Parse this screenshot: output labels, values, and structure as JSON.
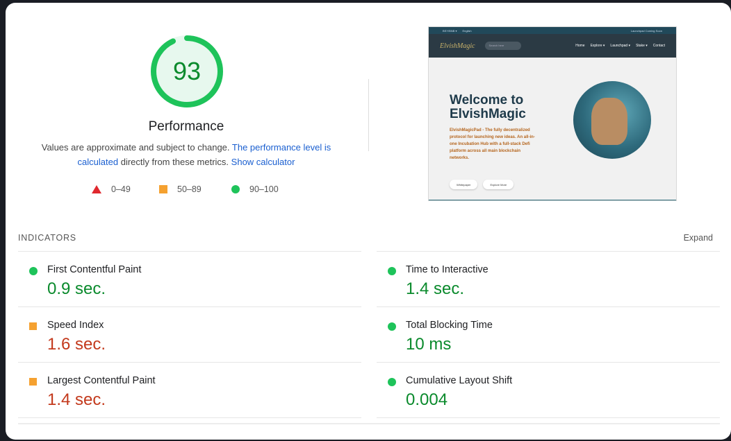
{
  "performance": {
    "score": "93",
    "score_fraction": 0.93,
    "title": "Performance",
    "desc_prefix": "Values are approximate and subject to change.",
    "desc_link1": "The performance level is calculated",
    "desc_middle": "directly from these metrics.",
    "desc_link2": "Show calculator"
  },
  "legend": [
    {
      "range": "0–49",
      "shape": "triangle",
      "color": "#e0282e"
    },
    {
      "range": "50–89",
      "shape": "square",
      "color": "#f5a130"
    },
    {
      "range": "90–100",
      "shape": "circle",
      "color": "#1ec35a"
    }
  ],
  "thumbnail": {
    "topbar_left": "BSY/BNB ▾",
    "topbar_lang": "English",
    "topbar_right": "Launchpad Coming Soon",
    "logo": "ElvishMagic",
    "search_placeholder": "Search here",
    "nav": [
      "Home",
      "Explore ▾",
      "Launchpad ▾",
      "Stake ▾",
      "Contact"
    ],
    "hero_title": "Welcome to ElvishMagic",
    "hero_text": "ElvishMagicPad - The fully decentralized protocol for launching new ideas. An all-in-one Incubation Hub with a full-stack Defi platform across all main blockchain networks.",
    "btn_whitepaper": "Whitepaper",
    "btn_explore": "Explore More"
  },
  "indicators": {
    "header": "INDICATORS",
    "expand": "Expand",
    "left": [
      {
        "label": "First Contentful Paint",
        "value": "0.9 sec.",
        "status": "good"
      },
      {
        "label": "Speed Index",
        "value": "1.6 sec.",
        "status": "average"
      },
      {
        "label": "Largest Contentful Paint",
        "value": "1.4 sec.",
        "status": "average"
      }
    ],
    "right": [
      {
        "label": "Time to Interactive",
        "value": "1.4 sec.",
        "status": "good"
      },
      {
        "label": "Total Blocking Time",
        "value": "10 ms",
        "status": "good"
      },
      {
        "label": "Cumulative Layout Shift",
        "value": "0.004",
        "status": "good"
      }
    ]
  },
  "colors": {
    "good": "#0a8a2c",
    "average": "#c3391c",
    "good_dot": "#1ec35a",
    "avg_square": "#f5a130",
    "link": "#1a5fd0"
  }
}
